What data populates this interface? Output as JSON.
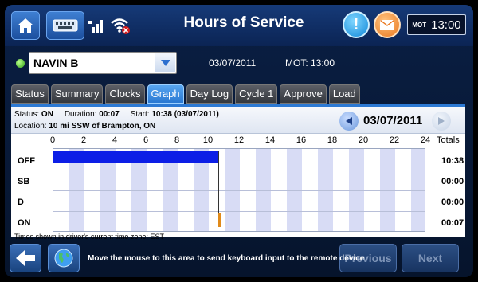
{
  "header": {
    "title": "Hours of Service",
    "clock_label": "MOT",
    "clock_time": "13:00"
  },
  "driver": {
    "name": "NAVIN B",
    "date": "03/07/2011",
    "mot": "MOT: 13:00",
    "status_color": "#3fae1c"
  },
  "tabs": [
    "Status",
    "Summary",
    "Clocks",
    "Graph",
    "Day Log",
    "Cycle 1",
    "Approve",
    "Load"
  ],
  "active_tab": "Graph",
  "info": {
    "status_label": "Status:",
    "status_value": "ON",
    "duration_label": "Duration:",
    "duration_value": "00:07",
    "start_label": "Start:",
    "start_value": "10:38 (03/07/2011)",
    "location_label": "Location:",
    "location_value": "10 mi SSW of Brampton, ON",
    "date": "03/07/2011"
  },
  "graph": {
    "hour_labels": [
      "0",
      "2",
      "4",
      "6",
      "8",
      "10",
      "12",
      "14",
      "16",
      "18",
      "20",
      "22",
      "24"
    ],
    "totals_label": "Totals",
    "rows": [
      {
        "label": "OFF",
        "total": "10:38"
      },
      {
        "label": "SB",
        "total": "00:00"
      },
      {
        "label": "D",
        "total": "00:00"
      },
      {
        "label": "ON",
        "total": "00:07"
      }
    ],
    "off_duty_hours": 10.633,
    "on_duty_start_hours": 10.633,
    "on_duty_end_hours": 10.75,
    "bar_color": "#0c1ee6",
    "timezone_note": "Times shown in driver's current time zone: EST"
  },
  "footer": {
    "remote_message": "Move the mouse to this area to send keyboard input to the remote device",
    "previous_label": "Previous",
    "next_label": "Next"
  },
  "icons": [
    "home-icon",
    "keyboard-icon",
    "signal-icon",
    "wifi-off-icon",
    "info-icon",
    "mail-icon",
    "chevron-down-icon",
    "chevron-left-icon",
    "chevron-right-icon",
    "back-arrow-icon",
    "globe-icon"
  ]
}
